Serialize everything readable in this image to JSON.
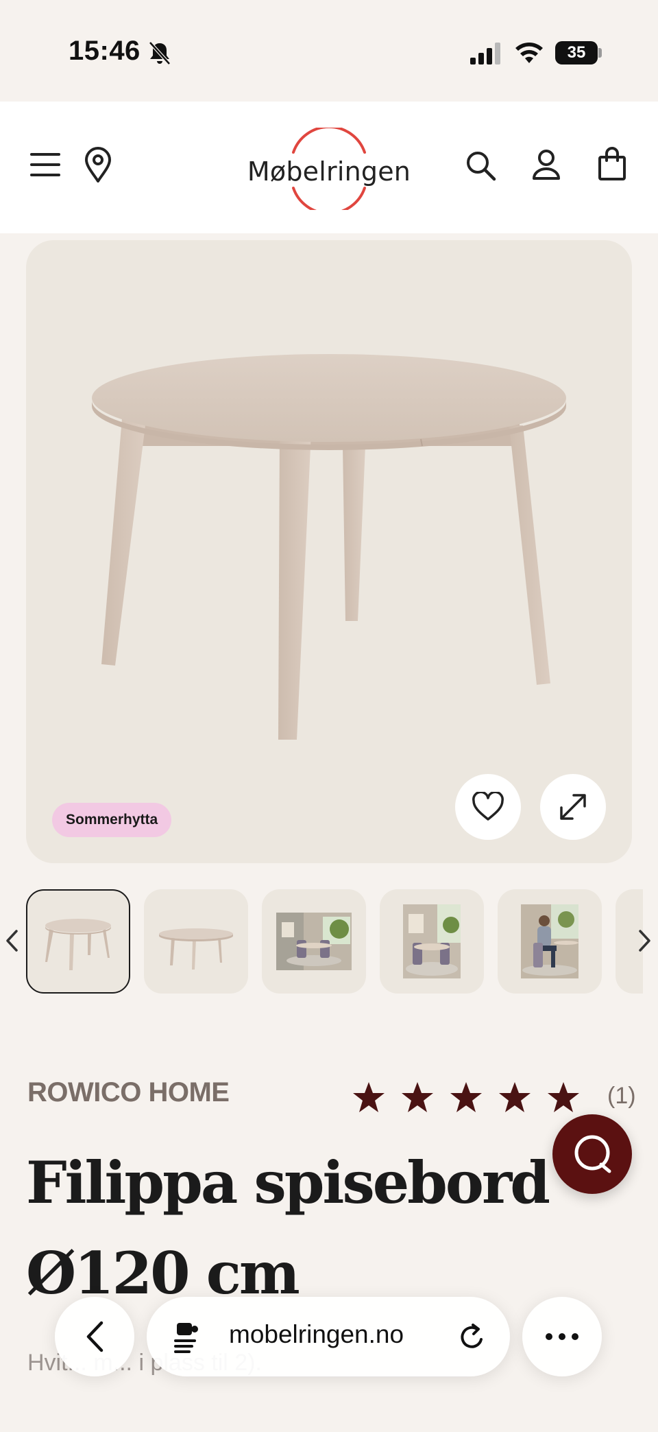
{
  "status_bar": {
    "time": "15:46",
    "battery": "35"
  },
  "header": {
    "logo_text": "Møbelringen",
    "icons": [
      "menu-icon",
      "location-icon",
      "search-icon",
      "user-icon",
      "shopping-bag-icon"
    ],
    "logo_ring_color": "#e0463f"
  },
  "gallery": {
    "tag": "Sommerhytta",
    "tag_color": "#f2c9e3",
    "thumbnails": [
      {
        "name": "thumb-table-angle",
        "active": true
      },
      {
        "name": "thumb-table-side",
        "active": false
      },
      {
        "name": "thumb-room-scene",
        "active": false
      },
      {
        "name": "thumb-room-closeup",
        "active": false
      },
      {
        "name": "thumb-person-seated",
        "active": false
      }
    ]
  },
  "product": {
    "brand": "ROWICO HOME",
    "rating": 5,
    "review_count": "(1)",
    "title": "Filippa spisebord Ø120 cm",
    "description": "Hvit... m... i plass til 2).",
    "star_color": "#4a1313"
  },
  "browser": {
    "url": "mobelringen.no"
  }
}
